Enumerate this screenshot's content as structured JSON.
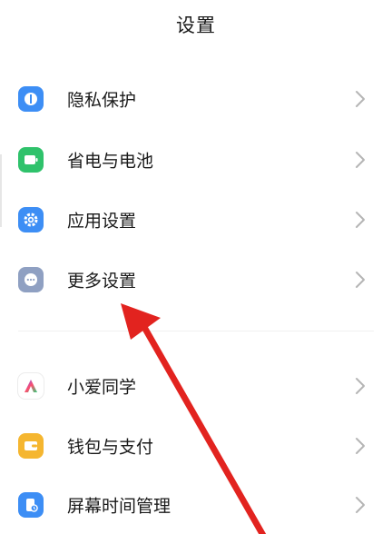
{
  "header": {
    "title": "设置"
  },
  "items": [
    {
      "label": "隐私保护",
      "icon": "privacy-shield-icon",
      "color": "#3d8ef5"
    },
    {
      "label": "省电与电池",
      "icon": "battery-icon",
      "color": "#2fc26b"
    },
    {
      "label": "应用设置",
      "icon": "gear-icon",
      "color": "#3d8ef5"
    },
    {
      "label": "更多设置",
      "icon": "more-dots-icon",
      "color": "#8fa0c2"
    },
    {
      "label": "小爱同学",
      "icon": "xiaoai-assistant-icon",
      "color": "#ffffff"
    },
    {
      "label": "钱包与支付",
      "icon": "wallet-icon",
      "color": "#f5b630"
    },
    {
      "label": "屏幕时间管理",
      "icon": "screen-time-icon",
      "color": "#3d8ef5"
    }
  ],
  "annotation": {
    "arrow_color": "#e2231f"
  }
}
